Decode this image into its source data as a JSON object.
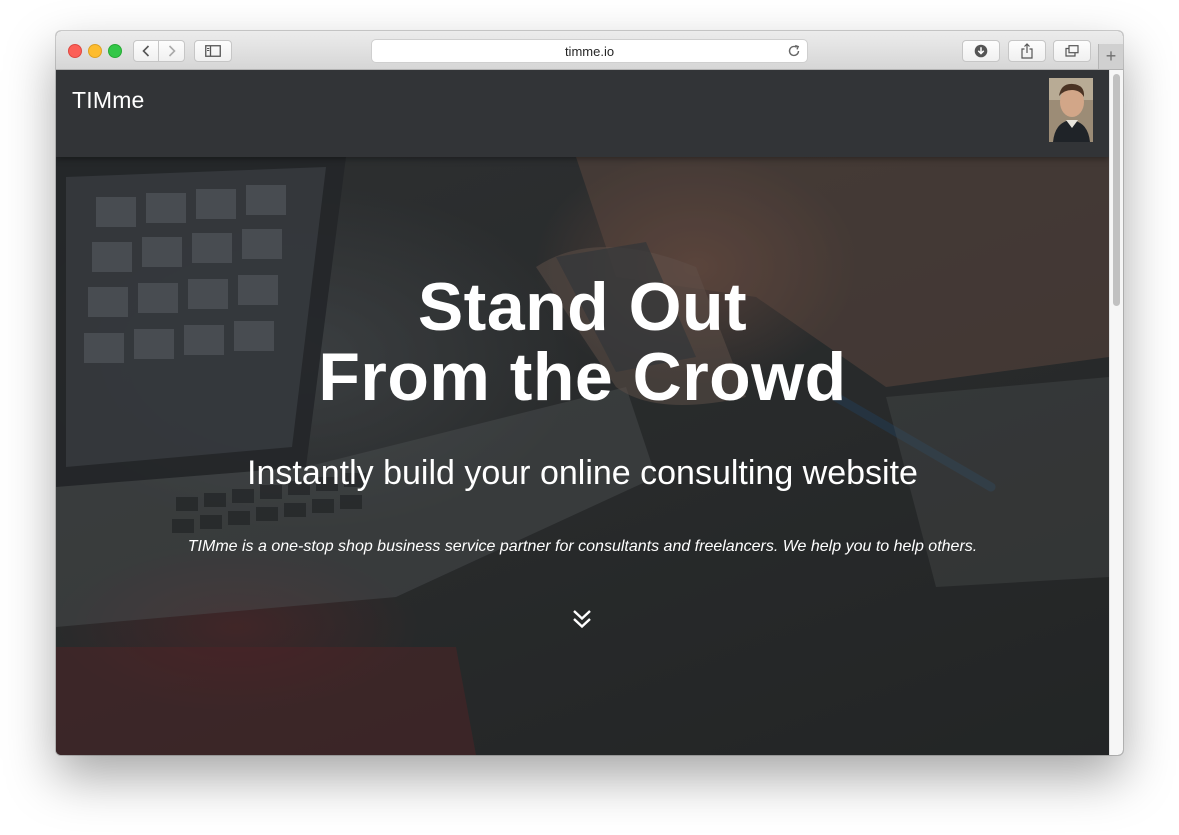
{
  "browser": {
    "url": "timme.io",
    "icons": {
      "back": "chevron-left-icon",
      "forward": "chevron-right-icon",
      "sidebar": "sidebar-icon",
      "reload": "reload-icon",
      "downloads": "download-icon",
      "share": "share-icon",
      "tabs": "tabs-icon",
      "new_tab": "plus-icon"
    },
    "new_tab_glyph": "+"
  },
  "site": {
    "brand": "TIMme",
    "avatar_icon": "user-avatar"
  },
  "hero": {
    "title_line1": "Stand Out",
    "title_line2": "From the Crowd",
    "subtitle": "Instantly build your online consulting website",
    "description": "TIMme is a one-stop shop business service partner for consultants and freelancers. We help you to help others.",
    "scroll_icon": "double-chevron-down-icon"
  },
  "colors": {
    "header_bg": "#323437",
    "hero_overlay": "#2f3133",
    "text": "#ffffff"
  }
}
